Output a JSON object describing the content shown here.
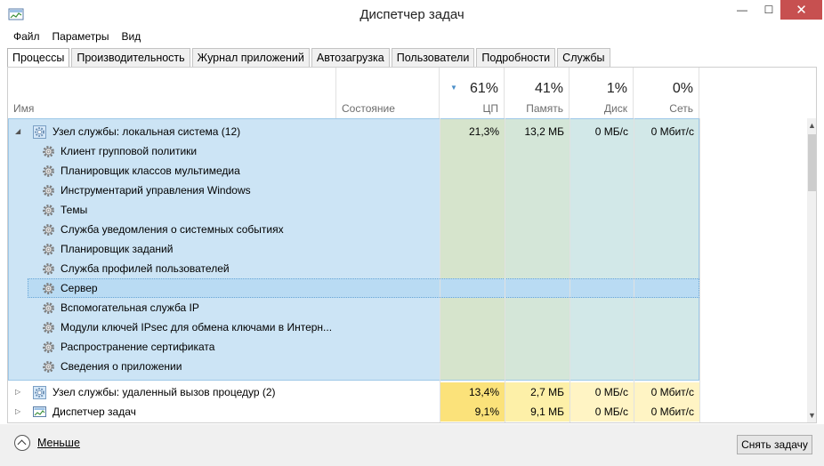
{
  "window": {
    "title": "Диспетчер задач"
  },
  "menu": [
    "Файл",
    "Параметры",
    "Вид"
  ],
  "tabs": [
    "Процессы",
    "Производительность",
    "Журнал приложений",
    "Автозагрузка",
    "Пользователи",
    "Подробности",
    "Службы"
  ],
  "columns": {
    "name": "Имя",
    "status": "Состояние",
    "cpu": {
      "pct": "61%",
      "label": "ЦП"
    },
    "mem": {
      "pct": "41%",
      "label": "Память"
    },
    "disk": {
      "pct": "1%",
      "label": "Диск"
    },
    "net": {
      "pct": "0%",
      "label": "Сеть"
    }
  },
  "groups": [
    {
      "name": "Узел службы: локальная система (12)",
      "cpu": "21,3%",
      "mem": "13,2 МБ",
      "disk": "0 МБ/с",
      "net": "0 Мбит/с",
      "expanded": true,
      "children": [
        "Клиент групповой политики",
        "Планировщик классов мультимедиа",
        "Инструментарий управления Windows",
        "Темы",
        "Служба уведомления о системных событиях",
        "Планировщик заданий",
        "Служба профилей пользователей",
        "Сервер",
        "Вспомогательная служба IP",
        "Модули ключей IPsec для обмена ключами в Интерн...",
        "Распространение сертификата",
        "Сведения о приложении"
      ]
    },
    {
      "name": "Узел службы: удаленный вызов процедур (2)",
      "cpu": "13,4%",
      "mem": "2,7 МБ",
      "disk": "0 МБ/с",
      "net": "0 Мбит/с",
      "expanded": false
    },
    {
      "name": "Диспетчер задач",
      "cpu": "9,1%",
      "mem": "9,1 МБ",
      "disk": "0 МБ/с",
      "net": "0 Мбит/с",
      "expanded": false
    }
  ],
  "footer": {
    "less": "Меньше",
    "end_task": "Снять задачу"
  },
  "colors": {
    "selection": "#cce4f5",
    "heat_high": "#fbe27a",
    "heat_mid": "#fdf0a8",
    "heat_low": "#fff4c4"
  }
}
